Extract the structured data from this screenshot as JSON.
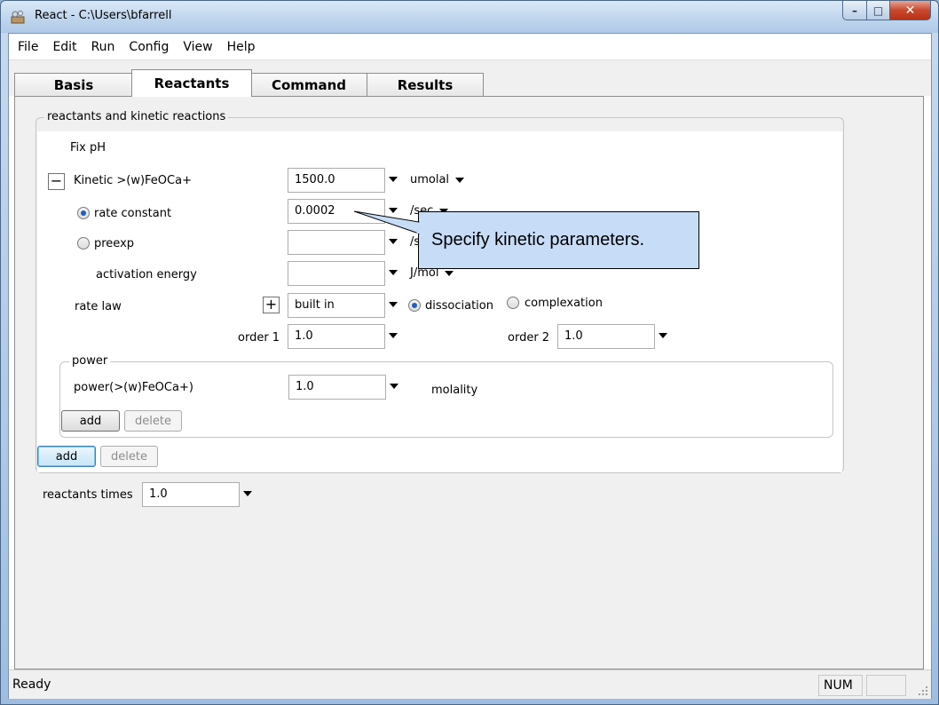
{
  "window": {
    "title": "React - C:\\Users\\bfarrell",
    "minimize_glyph": "–",
    "maximize_glyph": "□",
    "close_glyph": "✕"
  },
  "menu": [
    "File",
    "Edit",
    "Run",
    "Config",
    "View",
    "Help"
  ],
  "tabs": [
    "Basis",
    "Reactants",
    "Command",
    "Results"
  ],
  "active_tab": "Reactants",
  "group": {
    "legend": "reactants and kinetic reactions",
    "fix_ph": "Fix pH",
    "kinetic": {
      "toggle_glyph": "−",
      "label": "Kinetic  >(w)FeOCa+",
      "amount": "1500.0",
      "amount_unit": "umolal",
      "rate_constant_label": "rate constant",
      "rate_constant_value": "0.0002",
      "rate_constant_unit": "/sec",
      "preexp_label": "preexp",
      "preexp_value": "",
      "preexp_unit": "/s",
      "activation_energy_label": "activation energy",
      "activation_energy_value": "",
      "activation_energy_unit": "J/mol",
      "rate_law_label": "rate law",
      "rate_law_plus": "+",
      "rate_law_value": "built in",
      "dissociation_label": "dissociation",
      "complexation_label": "complexation",
      "order1_label": "order 1",
      "order1_value": "1.0",
      "order2_label": "order 2",
      "order2_value": "1.0"
    },
    "power": {
      "legend": "power",
      "term_label": "power(>(w)FeOCa+)",
      "term_value": "1.0",
      "term_unit": "molality",
      "add_label": "add",
      "delete_label": "delete"
    },
    "add_label": "add",
    "delete_label": "delete"
  },
  "reactants_times": {
    "label": "reactants times",
    "value": "1.0"
  },
  "tooltip": "Specify kinetic parameters.",
  "status": {
    "text": "Ready",
    "num": "NUM"
  },
  "colors": {
    "tooltip_bg": "#c7dcf7",
    "close_button": "#c9482e",
    "titlebar": "#c2d7ee"
  }
}
